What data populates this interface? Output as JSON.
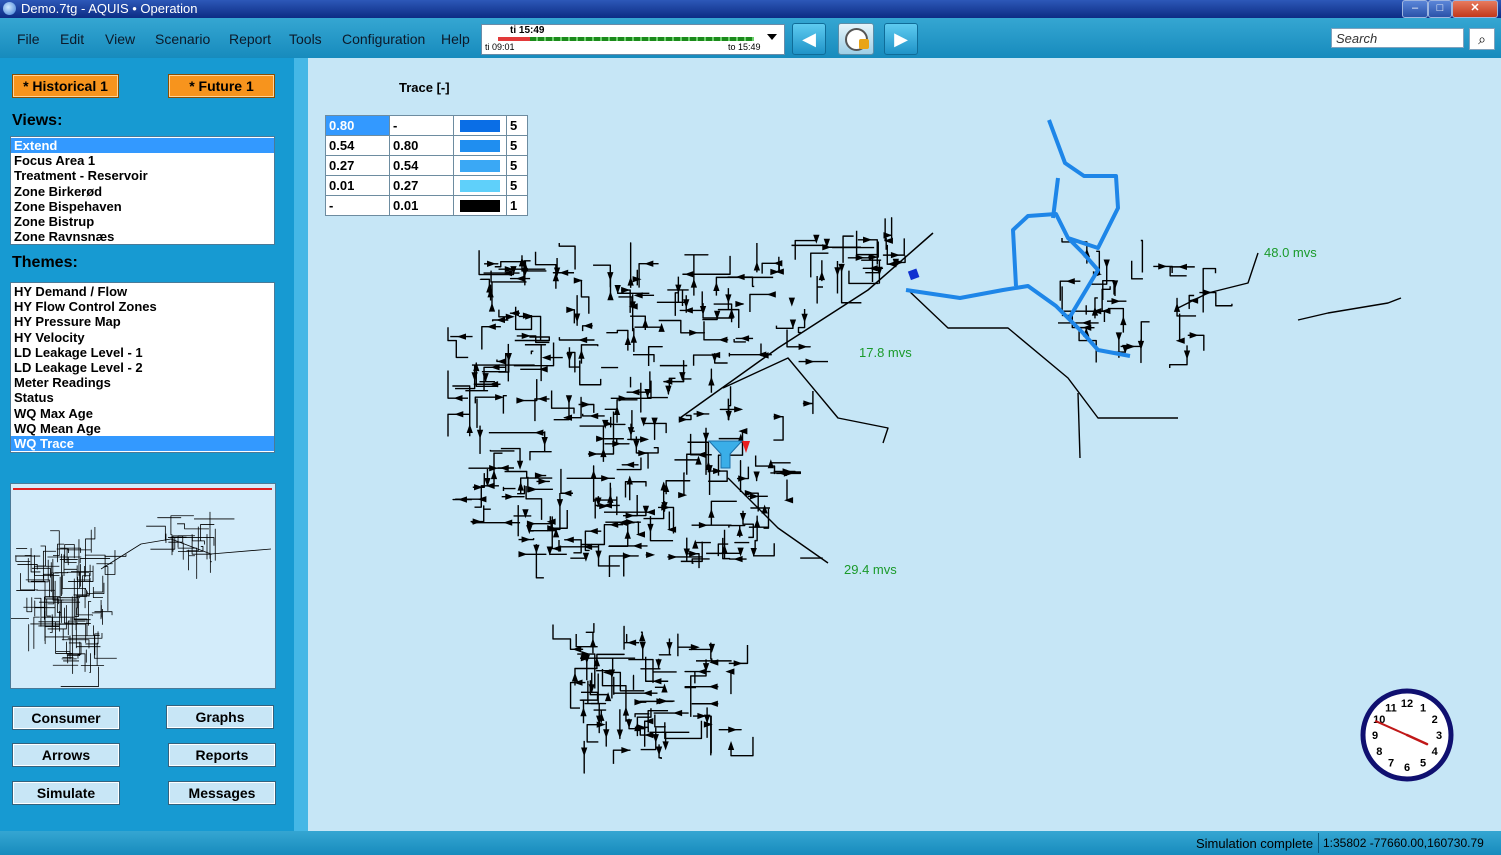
{
  "window": {
    "title": "Demo.7tg - AQUIS • Operation",
    "min": "–",
    "max": "□",
    "close": "✕"
  },
  "menu": [
    "File",
    "Edit",
    "View",
    "Scenario",
    "Report",
    "Tools",
    "Configuration",
    "Help"
  ],
  "timeline": {
    "now": "ti 15:49",
    "from": "ti 09:01",
    "to": "to 15:49"
  },
  "toolbar": {
    "back_icon": "arrow-left-icon",
    "forward_icon": "arrow-right-icon",
    "clock_icon": "clock-lock-icon",
    "back_glyph": "◀",
    "forward_glyph": "▶"
  },
  "search": {
    "placeholder": "Search",
    "icon": "magnifier-icon",
    "glyph": "⌕"
  },
  "scenarios": {
    "historical": "* Historical 1",
    "future": "* Future 1"
  },
  "views": {
    "heading": "Views:",
    "items": [
      "Extend",
      "Focus Area 1",
      "Treatment - Reservoir",
      "Zone Birkerød",
      "Zone Bispehaven",
      "Zone Bistrup",
      "Zone Ravnsnæs"
    ],
    "selected": "Extend"
  },
  "themes": {
    "heading": "Themes:",
    "items": [
      "HY Demand / Flow",
      "HY Flow Control Zones",
      "HY Pressure Map",
      "HY Velocity",
      "LD Leakage Level - 1",
      "LD Leakage Level - 2",
      "Meter Readings",
      "Status",
      "WQ Max Age",
      "WQ Mean Age",
      "WQ Trace"
    ],
    "selected": "WQ Trace"
  },
  "buttons": {
    "consumer": "Consumer",
    "graphs": "Graphs",
    "arrows": "Arrows",
    "reports": "Reports",
    "simulate": "Simulate",
    "messages": "Messages"
  },
  "legend": {
    "title": "Trace [-]",
    "rows": [
      {
        "from": "0.80",
        "to": "-",
        "color": "#0a6ee6",
        "count": "5"
      },
      {
        "from": "0.54",
        "to": "0.80",
        "color": "#1f8ef0",
        "count": "5"
      },
      {
        "from": "0.27",
        "to": "0.54",
        "color": "#3aa8f5",
        "count": "5"
      },
      {
        "from": "0.01",
        "to": "0.27",
        "color": "#5fd0fa",
        "count": "5"
      },
      {
        "from": "-",
        "to": "0.01",
        "color": "#000000",
        "count": "1"
      }
    ]
  },
  "map_labels": {
    "a": "48.0 mvs",
    "b": "17.8 mvs",
    "c": "29.4 mvs"
  },
  "colors": {
    "trace": "#1e86e8",
    "network": "#000000",
    "label_green": "#1a9a2a",
    "panel": "#179ad2",
    "accent_orange": "#f7941d"
  },
  "clock": {
    "numerals": [
      "12",
      "1",
      "2",
      "3",
      "4",
      "5",
      "6",
      "7",
      "8",
      "9",
      "10",
      "11"
    ],
    "hour": 15,
    "minute": 49
  },
  "status": {
    "message": "Simulation complete",
    "coords": "1:35802  -77660.00,160730.79"
  }
}
